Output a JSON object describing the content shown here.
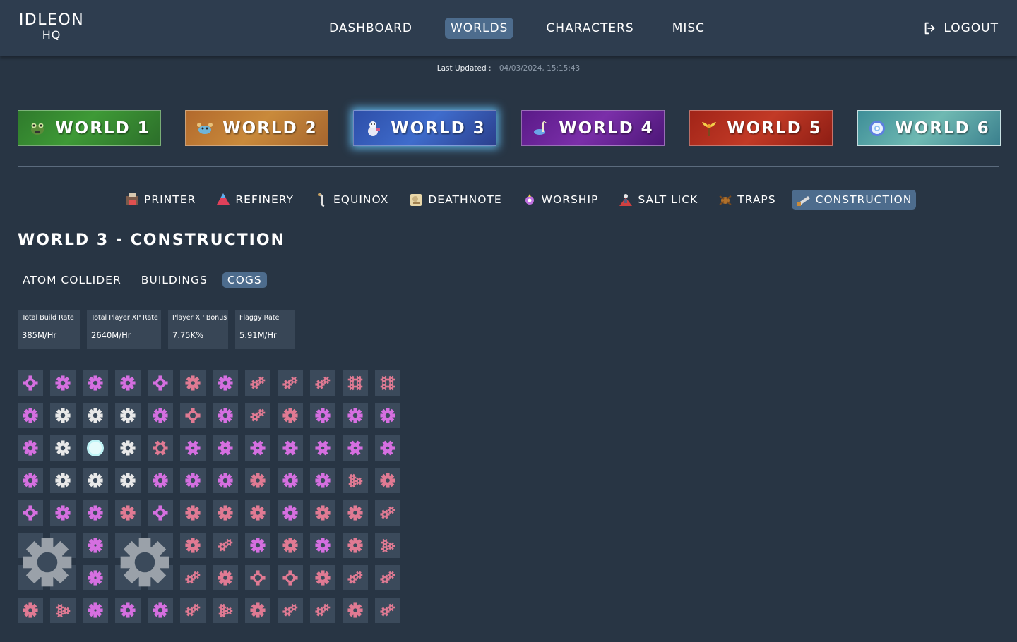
{
  "logo": {
    "line1": "IDLEON",
    "line2": "HQ"
  },
  "nav": {
    "items": [
      "DASHBOARD",
      "WORLDS",
      "CHARACTERS",
      "MISC"
    ],
    "active": "WORLDS",
    "logout": "LOGOUT"
  },
  "updated": {
    "label": "Last Updated :",
    "value": "04/03/2024, 15:15:43"
  },
  "worlds": [
    {
      "label": "WORLD 1",
      "icon": "frog-icon"
    },
    {
      "label": "WORLD 2",
      "icon": "crab-icon"
    },
    {
      "label": "WORLD 3",
      "icon": "snowman-icon",
      "active": true
    },
    {
      "label": "WORLD 4",
      "icon": "bird-icon"
    },
    {
      "label": "WORLD 5",
      "icon": "plant-icon"
    },
    {
      "label": "WORLD 6",
      "icon": "flower-icon"
    }
  ],
  "subnav": {
    "items": [
      {
        "label": "PRINTER",
        "icon": "printer-icon"
      },
      {
        "label": "REFINERY",
        "icon": "refinery-icon"
      },
      {
        "label": "EQUINOX",
        "icon": "equinox-icon"
      },
      {
        "label": "DEATHNOTE",
        "icon": "deathnote-icon"
      },
      {
        "label": "WORSHIP",
        "icon": "worship-icon"
      },
      {
        "label": "SALT LICK",
        "icon": "salt-lick-icon"
      },
      {
        "label": "TRAPS",
        "icon": "traps-icon"
      },
      {
        "label": "CONSTRUCTION",
        "icon": "construction-icon"
      }
    ],
    "active": "CONSTRUCTION"
  },
  "page_title": "WORLD 3 - CONSTRUCTION",
  "tabs": {
    "items": [
      "ATOM COLLIDER",
      "BUILDINGS",
      "COGS"
    ],
    "active": "COGS"
  },
  "stats": [
    {
      "label": "Total Build Rate",
      "value": "385M/Hr"
    },
    {
      "label": "Total Player XP Rate",
      "value": "2640M/Hr"
    },
    {
      "label": "Player XP Bonus",
      "value": "7.75K%"
    },
    {
      "label": "Flaggy Rate",
      "value": "5.91M/Hr"
    }
  ],
  "colors": {
    "background": "#283544",
    "topbar": "#2e3d4f",
    "active_button": "#4d6c8d",
    "cell": "#3b4a5b",
    "cog_pink": "#e07a93",
    "cog_purple": "#d56fe0",
    "cog_white": "#e8e8e8",
    "cog_cyan": "#bff4f6",
    "cog_gray": "#9aa1a9"
  },
  "cog_grid": [
    [
      "pink-x",
      "purple",
      "purple",
      "purple",
      "pink-x",
      "pink",
      "purple",
      "multi",
      "multi",
      "multi",
      "cluster",
      "cluster"
    ],
    [
      "purple",
      "white",
      "white",
      "white",
      "purple",
      "pink-sq",
      "purple",
      "multi",
      "pink",
      "purple",
      "purple",
      "purple"
    ],
    [
      "purple",
      "white",
      "cyan",
      "white",
      "pink-ring",
      "purple-fat",
      "purple-fat",
      "purple-fat",
      "purple-fat",
      "purple-fat",
      "purple-fat",
      "purple-fat"
    ],
    [
      "purple",
      "white",
      "white",
      "white",
      "purple",
      "purple",
      "purple",
      "pink",
      "purple",
      "purple",
      "pink-tri",
      "pink"
    ],
    [
      "pink-x",
      "purple",
      "purple",
      "pink",
      "pink-x",
      "pink",
      "pink",
      "pink",
      "purple",
      "pink",
      "pink",
      "multi"
    ],
    [
      "big",
      "big",
      "purple-dot",
      "big",
      "big",
      "pink",
      "multi",
      "purple",
      "pink",
      "purple",
      "pink",
      "pink-tri"
    ],
    [
      "big",
      "big",
      "purple-dot",
      "big",
      "big",
      "multi",
      "pink",
      "pink-sq",
      "pink-sq",
      "pink",
      "multi",
      "multi"
    ],
    [
      "pink",
      "pink-tri",
      "purple-dot",
      "purple",
      "purple",
      "multi",
      "pink-tri",
      "pink",
      "multi",
      "multi",
      "pink",
      "multi"
    ]
  ]
}
